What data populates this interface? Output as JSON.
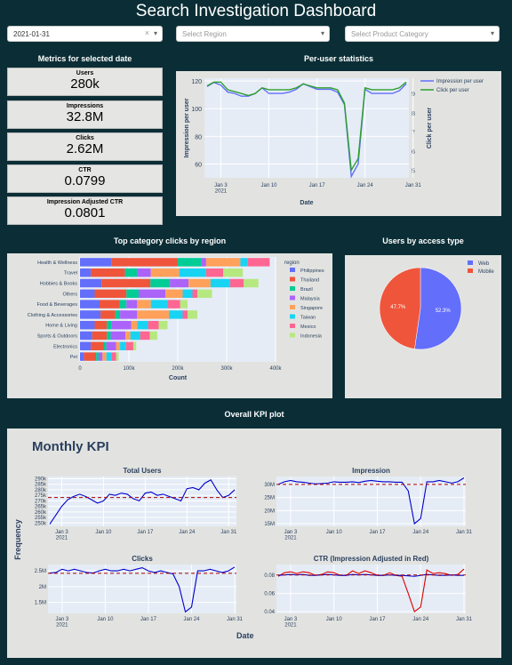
{
  "header": {
    "title": "Search Investigation Dashboard"
  },
  "filters": {
    "date": "2021-01-31",
    "region_placeholder": "Select Region",
    "category_placeholder": "Select Product Category",
    "clear": "×",
    "arrow": "▾"
  },
  "metrics": {
    "title": "Metrics for selected date",
    "items": [
      {
        "label": "Users",
        "value": "280k"
      },
      {
        "label": "Impressions",
        "value": "32.8M"
      },
      {
        "label": "Clicks",
        "value": "2.62M"
      },
      {
        "label": "CTR",
        "value": "0.0799"
      },
      {
        "label": "Impression Adjusted CTR",
        "value": "0.0801"
      }
    ]
  },
  "per_user": {
    "title": "Per-user statistics"
  },
  "clicks_region": {
    "title": "Top category clicks by region"
  },
  "access": {
    "title": "Users by access type"
  },
  "kpi": {
    "title": "Overall KPI plot",
    "panel_title": "Monthly KPI",
    "ylabel": "Frequency",
    "xlabel": "Date"
  },
  "colors": {
    "blue": "#636efa",
    "red": "#ef553b",
    "green": "#00cc96",
    "purple": "#ab63fa",
    "orange": "#ffa15a",
    "cyan": "#19d3f3",
    "pink": "#ff6692",
    "lime": "#b6e880",
    "bg": "#0b2e36",
    "panel": "#e2e3e0",
    "plot": "#e5ecf6"
  },
  "chart_data": [
    {
      "id": "per_user",
      "type": "line",
      "xlabel": "Date",
      "ylabel": "Impression per user",
      "y2label": "Click per user",
      "x_ticks": [
        "Jan 3\n2021",
        "Jan 10",
        "Jan 17",
        "Jan 24",
        "Jan 31"
      ],
      "y_ticks": [
        60,
        80,
        100,
        120
      ],
      "y2_ticks": [
        5,
        6,
        7,
        8,
        9
      ],
      "legend": "top-right",
      "series": [
        {
          "name": "Impression per user",
          "axis": "y",
          "values": [
            116,
            119,
            117,
            112,
            111,
            109,
            109,
            111,
            115,
            111,
            111,
            111,
            112,
            114,
            118,
            116,
            114,
            114,
            114,
            112,
            103,
            51,
            60,
            114,
            111,
            111,
            111,
            111,
            113,
            118
          ]
        },
        {
          "name": "Click per user",
          "axis": "y2",
          "values": [
            9.4,
            9.6,
            9.6,
            9.2,
            9.1,
            9.0,
            8.9,
            9.0,
            9.3,
            9.2,
            9.2,
            9.2,
            9.2,
            9.3,
            9.5,
            9.4,
            9.3,
            9.3,
            9.3,
            9.2,
            8.5,
            5.0,
            5.6,
            9.3,
            9.2,
            9.2,
            9.2,
            9.2,
            9.3,
            9.6
          ]
        }
      ]
    },
    {
      "id": "clicks_region",
      "type": "bar",
      "orientation": "horizontal",
      "xlabel": "Count",
      "legend_title": "region",
      "x_ticks": [
        "0",
        "100k",
        "200k",
        "300k",
        "400k"
      ],
      "xlim": [
        0,
        400000
      ],
      "categories": [
        "Health & Wellness",
        "Travel",
        "Hobbies & Books",
        "Others",
        "Food & Beverages",
        "Clothing & Accessories",
        "Home & Living",
        "Sports & Outdoors",
        "Electronics",
        "Pet"
      ],
      "series": [
        {
          "name": "Philippines",
          "values": [
            65000,
            22000,
            44000,
            30000,
            40000,
            42000,
            30000,
            25000,
            22000,
            8000
          ]
        },
        {
          "name": "Thailand",
          "values": [
            135000,
            70000,
            100000,
            65000,
            40000,
            30000,
            25000,
            30000,
            27000,
            25000
          ]
        },
        {
          "name": "Brazil",
          "values": [
            48000,
            25000,
            40000,
            25000,
            15000,
            10000,
            10000,
            8000,
            5000,
            5000
          ]
        },
        {
          "name": "Malaysia",
          "values": [
            10000,
            28000,
            38000,
            55000,
            22000,
            35000,
            40000,
            30000,
            20000,
            8000
          ]
        },
        {
          "name": "Singapore",
          "values": [
            70000,
            58000,
            45000,
            35000,
            28000,
            65000,
            12000,
            10000,
            8000,
            8000
          ]
        },
        {
          "name": "Taiwan",
          "values": [
            15000,
            55000,
            40000,
            20000,
            35000,
            28000,
            22000,
            20000,
            12000,
            10000
          ]
        },
        {
          "name": "Mexico",
          "values": [
            45000,
            35000,
            28000,
            10000,
            25000,
            10000,
            22000,
            20000,
            15000,
            10000
          ]
        },
        {
          "name": "Indonesia",
          "values": [
            0,
            40000,
            30000,
            30000,
            15000,
            20000,
            18000,
            15000,
            6000,
            5000
          ]
        }
      ]
    },
    {
      "id": "access",
      "type": "pie",
      "labels": [
        "Web",
        "Mobile"
      ],
      "values": [
        52.3,
        47.7
      ],
      "value_labels": [
        "52.3%",
        "47.7%"
      ],
      "legend": "top-right"
    },
    {
      "id": "kpi_users",
      "type": "line",
      "title": "Total Users",
      "y_ticks": [
        "250k",
        "255k",
        "260k",
        "265k",
        "270k",
        "275k",
        "280k",
        "285k",
        "290k"
      ],
      "ylim": [
        247000,
        292000
      ],
      "x_ticks": [
        "Jan 3\n2021",
        "Jan 10",
        "Jan 17",
        "Jan 24",
        "Jan 31"
      ],
      "mean": 273000,
      "values": [
        249000,
        257000,
        265000,
        271000,
        274000,
        276000,
        274000,
        271000,
        268000,
        270000,
        276000,
        275000,
        277000,
        276000,
        272000,
        270000,
        277000,
        278000,
        275000,
        276000,
        274000,
        272000,
        270000,
        281000,
        282000,
        280000,
        286000,
        289000,
        280000,
        273000,
        275000,
        280000
      ]
    },
    {
      "id": "kpi_impression",
      "type": "line",
      "title": "Impression",
      "y_ticks": [
        "15M",
        "20M",
        "25M",
        "30M"
      ],
      "ylim": [
        14000000,
        33000000
      ],
      "x_ticks": [
        "Jan 3\n2021",
        "Jan 10",
        "Jan 17",
        "Jan 24",
        "Jan 31"
      ],
      "mean": 30000000,
      "values": [
        30000000,
        31000000,
        31500000,
        31000000,
        30800000,
        30500000,
        30200000,
        30300000,
        30500000,
        31000000,
        30800000,
        30800000,
        31000000,
        30700000,
        31200000,
        31500000,
        31200000,
        31000000,
        31000000,
        30800000,
        30800000,
        27500000,
        15000000,
        17000000,
        31000000,
        31000000,
        31500000,
        31000000,
        30500000,
        31000000,
        32500000
      ]
    },
    {
      "id": "kpi_clicks",
      "type": "line",
      "title": "Clicks",
      "y_ticks": [
        "1.5M",
        "2M",
        "2.5M"
      ],
      "ylim": [
        1150000,
        2700000
      ],
      "x_ticks": [
        "Jan 3\n2021",
        "Jan 10",
        "Jan 17",
        "Jan 24",
        "Jan 31"
      ],
      "mean": 2420000,
      "values": [
        2430000,
        2450000,
        2550000,
        2500000,
        2550000,
        2500000,
        2450000,
        2430000,
        2500000,
        2550000,
        2500000,
        2500000,
        2550000,
        2500000,
        2550000,
        2600000,
        2500000,
        2450000,
        2500000,
        2450000,
        2400000,
        2000000,
        1200000,
        1350000,
        2500000,
        2500000,
        2550000,
        2500000,
        2450000,
        2500000,
        2620000
      ]
    },
    {
      "id": "kpi_ctr",
      "type": "line",
      "title": "CTR (Impression Adjusted in Red)",
      "y_ticks": [
        "0.04",
        "0.06",
        "0.08"
      ],
      "ylim": [
        0.038,
        0.092
      ],
      "x_ticks": [
        "Jan 3\n2021",
        "Jan 10",
        "Jan 17",
        "Jan 24",
        "Jan 31"
      ],
      "mean": 0.0805,
      "series": [
        {
          "name": "CTR",
          "values": [
            0.08,
            0.0805,
            0.081,
            0.0805,
            0.081,
            0.08,
            0.08,
            0.0805,
            0.081,
            0.0805,
            0.08,
            0.08,
            0.081,
            0.0805,
            0.081,
            0.0805,
            0.08,
            0.08,
            0.0805,
            0.08,
            0.08,
            0.0795,
            0.079,
            0.08,
            0.081,
            0.0805,
            0.08,
            0.08,
            0.0805,
            0.08,
            0.08
          ]
        },
        {
          "name": "Impression Adjusted CTR",
          "values": [
            0.079,
            0.083,
            0.084,
            0.082,
            0.084,
            0.083,
            0.08,
            0.081,
            0.084,
            0.083,
            0.08,
            0.08,
            0.085,
            0.082,
            0.085,
            0.083,
            0.08,
            0.08,
            0.083,
            0.08,
            0.079,
            0.06,
            0.04,
            0.045,
            0.086,
            0.082,
            0.083,
            0.082,
            0.08,
            0.081,
            0.087
          ]
        }
      ]
    }
  ]
}
